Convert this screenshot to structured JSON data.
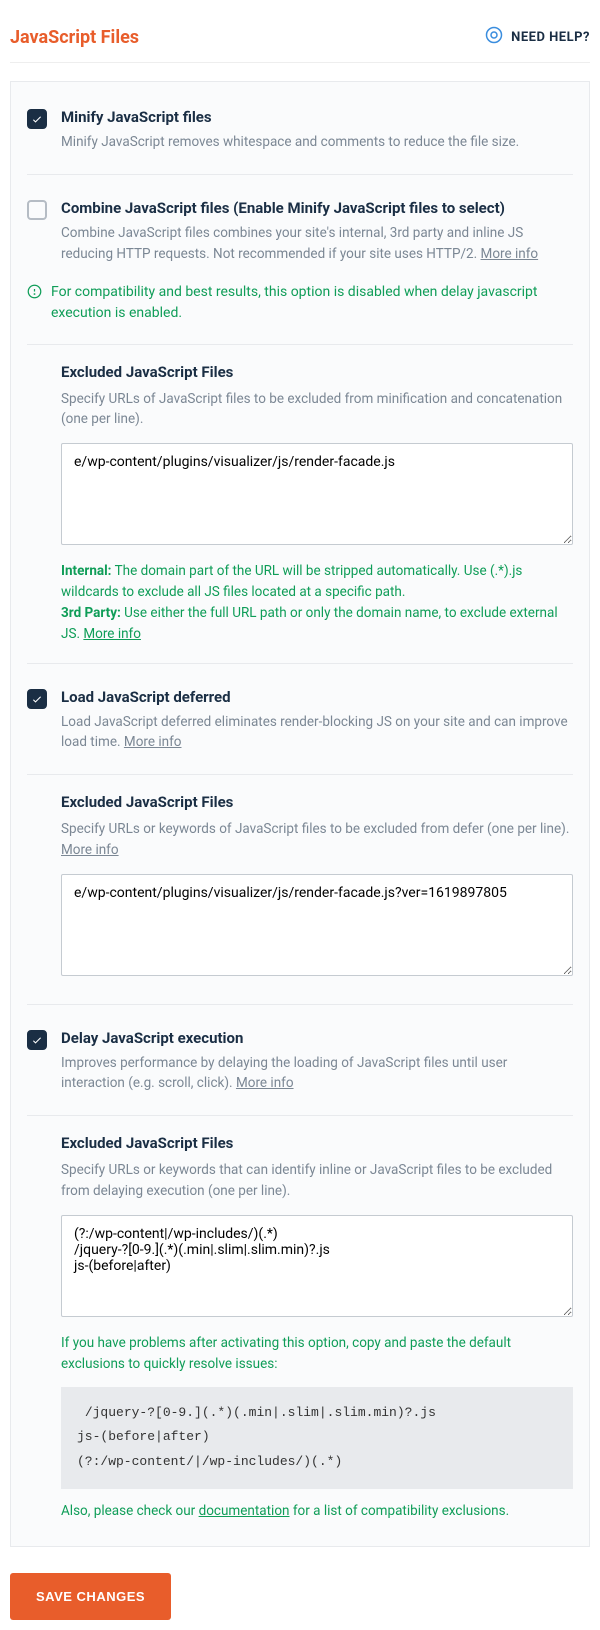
{
  "header": {
    "title": "JavaScript Files",
    "help_label": "NEED HELP?"
  },
  "minify": {
    "title": "Minify JavaScript files",
    "desc": "Minify JavaScript removes whitespace and comments to reduce the file size."
  },
  "combine": {
    "title": "Combine JavaScript files (Enable Minify JavaScript files to select)",
    "desc": "Combine JavaScript files combines your site's internal, 3rd party and inline JS reducing HTTP requests. Not recommended if your site uses HTTP/2. ",
    "more_info": "More info",
    "note": "For compatibility and best results, this option is disabled when delay javascript execution is enabled."
  },
  "excluded1": {
    "title": "Excluded JavaScript Files",
    "desc": "Specify URLs of JavaScript files to be excluded from minification and concatenation (one per line).",
    "value": "e/wp-content/plugins/visualizer/js/render-facade.js",
    "note_internal_label": "Internal:",
    "note_internal": " The domain part of the URL will be stripped automatically. Use (.*).js wildcards to exclude all JS files located at a specific path.",
    "note_3rd_label": "3rd Party:",
    "note_3rd": " Use either the full URL path or only the domain name, to exclude external JS. ",
    "more_info": "More info"
  },
  "defer": {
    "title": "Load JavaScript deferred",
    "desc": "Load JavaScript deferred eliminates render-blocking JS on your site and can improve load time. ",
    "more_info": "More info"
  },
  "excluded2": {
    "title": "Excluded JavaScript Files",
    "desc_pre": "Specify URLs or keywords of JavaScript files to be excluded from defer (one per line). ",
    "more_info": "More info",
    "value": "e/wp-content/plugins/visualizer/js/render-facade.js?ver=1619897805"
  },
  "delay": {
    "title": "Delay JavaScript execution",
    "desc": "Improves performance by delaying the loading of JavaScript files until user interaction (e.g. scroll, click). ",
    "more_info": "More info"
  },
  "excluded3": {
    "title": "Excluded JavaScript Files",
    "desc": "Specify URLs or keywords that can identify inline or JavaScript files to be excluded from delaying execution (one per line).",
    "value": "(?:/wp-content|/wp-includes/)(.*)\n/jquery-?[0-9.](.*)(.min|.slim|.slim.min)?.js\njs-(before|after)",
    "note1": "If you have problems after activating this option, copy and paste the default exclusions to quickly resolve issues:",
    "code": " /jquery-?[0-9.](.*)(.min|.slim|.slim.min)?.js\njs-(before|after)\n(?:/wp-content/|/wp-includes/)(.*)",
    "note2_pre": "Also, please check our ",
    "note2_link": "documentation",
    "note2_post": " for a list of compatibility exclusions."
  },
  "save_label": "SAVE CHANGES"
}
